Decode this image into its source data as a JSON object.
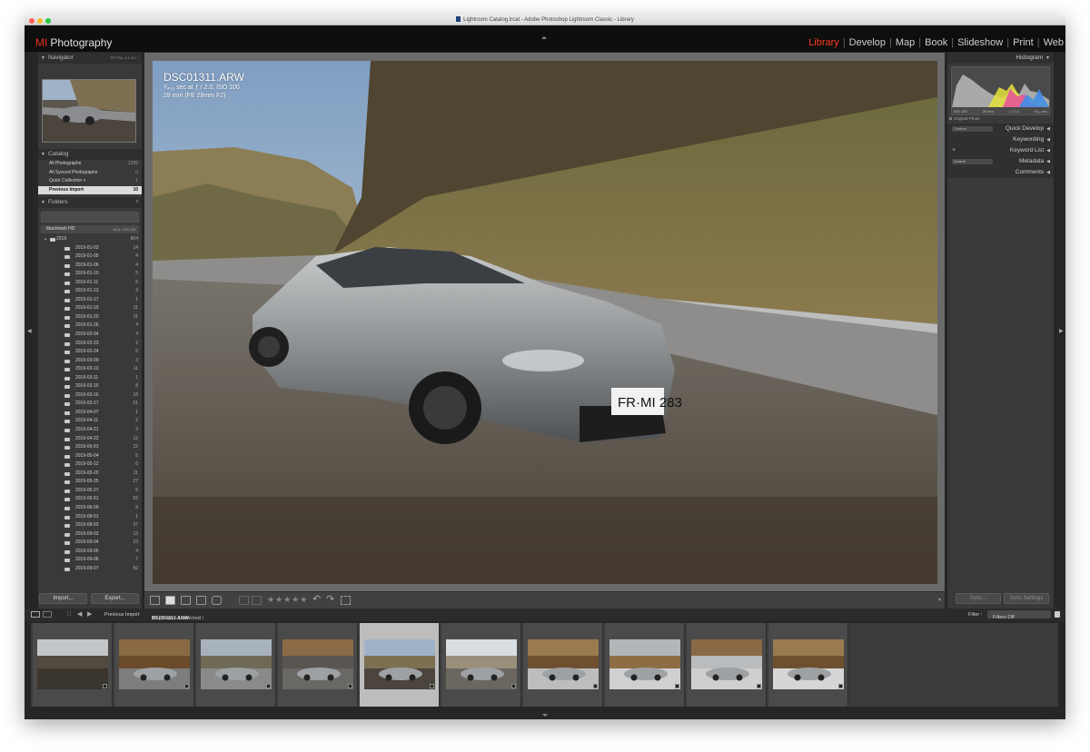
{
  "window": {
    "title": "Lightroom Catalog.lrcat - Adobe Photoshop Lightroom Classic - Library",
    "traffic_lights": [
      "#ff5f57",
      "#febc2e",
      "#28c840"
    ]
  },
  "identity_plate": {
    "mark": "MI",
    "text": "Photography",
    "mark_color": "#e5311b"
  },
  "modules": [
    {
      "label": "Library",
      "active": true
    },
    {
      "label": "Develop"
    },
    {
      "label": "Map"
    },
    {
      "label": "Book"
    },
    {
      "label": "Slideshow"
    },
    {
      "label": "Print"
    },
    {
      "label": "Web"
    }
  ],
  "navigator": {
    "title": "Navigator",
    "zoom_options": "FIT  FILL  1:1  3:1 ÷"
  },
  "catalog": {
    "title": "Catalog",
    "items": [
      {
        "label": "All Photographs",
        "count": "1395"
      },
      {
        "label": "All Synced Photographs",
        "count": "0"
      },
      {
        "label": "Quick Collection +",
        "count": "1"
      },
      {
        "label": "Previous Import",
        "count": "10"
      }
    ]
  },
  "folders": {
    "title": "Folders",
    "add": "+",
    "volume": {
      "label": "Macintosh HD",
      "size": "46.5 / 251 GB"
    },
    "root": {
      "label": "2019",
      "count": "864"
    },
    "items": [
      {
        "label": "2019-01-03",
        "count": "14"
      },
      {
        "label": "2019-01-05",
        "count": "4"
      },
      {
        "label": "2019-01-06",
        "count": "4"
      },
      {
        "label": "2019-01-10",
        "count": "5"
      },
      {
        "label": "2019-01-11",
        "count": "5"
      },
      {
        "label": "2019-01-13",
        "count": "3"
      },
      {
        "label": "2019-01-17",
        "count": "1"
      },
      {
        "label": "2019-01-19",
        "count": "11"
      },
      {
        "label": "2019-01-20",
        "count": "11"
      },
      {
        "label": "2019-01-26",
        "count": "4"
      },
      {
        "label": "2019-02-04",
        "count": "4"
      },
      {
        "label": "2019-02-23",
        "count": "2"
      },
      {
        "label": "2019-02-24",
        "count": "5"
      },
      {
        "label": "2019-03-09",
        "count": "3"
      },
      {
        "label": "2019-03-10",
        "count": "11"
      },
      {
        "label": "2019-03-11",
        "count": "1"
      },
      {
        "label": "2019-03-15",
        "count": "8"
      },
      {
        "label": "2019-03-16",
        "count": "18"
      },
      {
        "label": "2019-03-17",
        "count": "51"
      },
      {
        "label": "2019-04-07",
        "count": "1"
      },
      {
        "label": "2019-04-11",
        "count": "2"
      },
      {
        "label": "2019-04-21",
        "count": "3"
      },
      {
        "label": "2019-04-22",
        "count": "12"
      },
      {
        "label": "2019-05-01",
        "count": "22"
      },
      {
        "label": "2019-05-04",
        "count": "5"
      },
      {
        "label": "2019-05-12",
        "count": "6"
      },
      {
        "label": "2019-05-20",
        "count": "11"
      },
      {
        "label": "2019-05-25",
        "count": "27"
      },
      {
        "label": "2019-05-27",
        "count": "5"
      },
      {
        "label": "2019-06-01",
        "count": "52"
      },
      {
        "label": "2019-06-09",
        "count": "8"
      },
      {
        "label": "2019-08-01",
        "count": "1"
      },
      {
        "label": "2019-08-03",
        "count": "37"
      },
      {
        "label": "2019-09-03",
        "count": "13"
      },
      {
        "label": "2019-09-04",
        "count": "23"
      },
      {
        "label": "2019-09-05",
        "count": "4"
      },
      {
        "label": "2019-09-06",
        "count": "7"
      },
      {
        "label": "2019-09-07",
        "count": "82"
      }
    ]
  },
  "left_buttons": {
    "import": "Import...",
    "export": "Export..."
  },
  "photo_info": {
    "filename": "DSC01311.ARW",
    "exposure": "¹⁄₈₀₀ sec at ƒ / 2.0, ISO 100",
    "lens": "28 mm (FE 28mm F2)",
    "plate": "FR·MI 283"
  },
  "histogram": {
    "title": "Histogram",
    "iso": "ISO 100",
    "focal": "28 mm",
    "aperture": "ƒ / 2.0",
    "shutter": "¹⁄₈₀₀ sec",
    "original_photo": "Original Photo"
  },
  "right_panels": [
    {
      "label": "Quick Develop",
      "preset": "Custom"
    },
    {
      "label": "Keywording"
    },
    {
      "label": "Keyword List",
      "prefix": "+"
    },
    {
      "label": "Metadata",
      "preset": "Default"
    },
    {
      "label": "Comments"
    }
  ],
  "right_buttons": {
    "sync": "Sync...",
    "sync_settings": "Sync Settings"
  },
  "filmstrip": {
    "source": "Previous Import",
    "selection": "10 photos / 1 selected /",
    "current_file": "DSC01311.ARW",
    "dropdown": "▾",
    "filter_label": "Filter :",
    "filter_value": "Filters Off",
    "selected_index": 4
  }
}
